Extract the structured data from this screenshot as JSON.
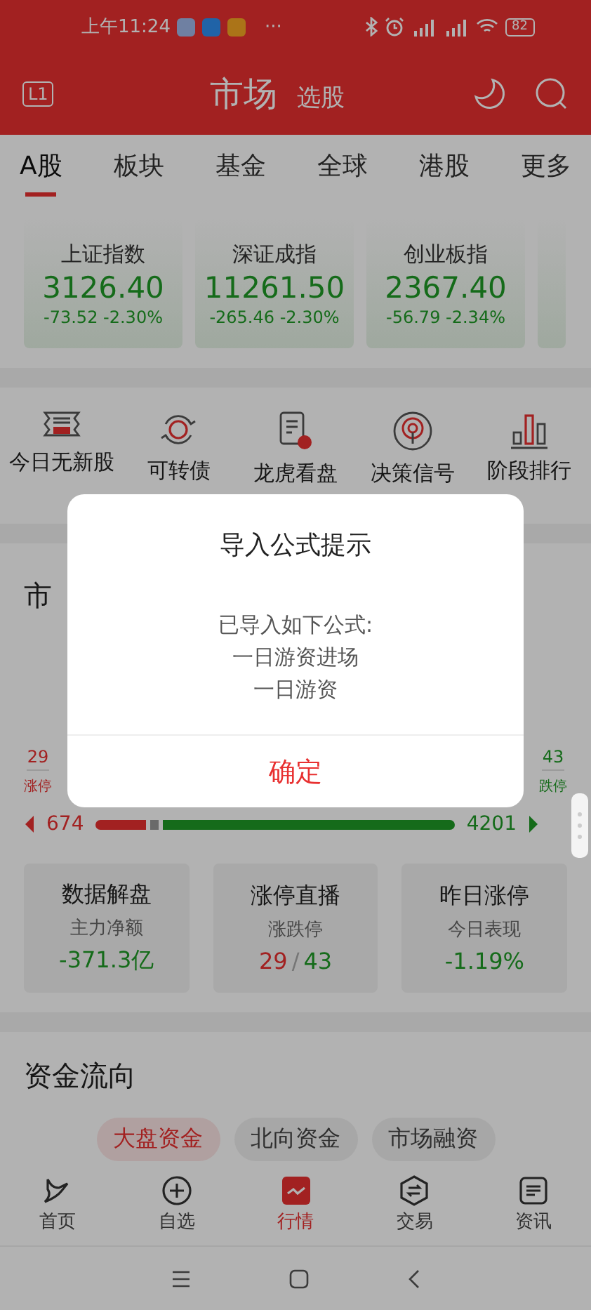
{
  "status_bar": {
    "time": "上午11:24",
    "more": "···",
    "battery": "82"
  },
  "header": {
    "badge": "L1",
    "title": "市场",
    "subtitle": "选股"
  },
  "tabs": [
    {
      "label": "A股",
      "selected": true
    },
    {
      "label": "板块",
      "selected": false
    },
    {
      "label": "基金",
      "selected": false
    },
    {
      "label": "全球",
      "selected": false
    },
    {
      "label": "港股",
      "selected": false
    },
    {
      "label": "更多",
      "selected": false
    }
  ],
  "indices": [
    {
      "name": "上证指数",
      "value": "3126.40",
      "change": "-73.52",
      "percent": "-2.30%"
    },
    {
      "name": "深证成指",
      "value": "11261.50",
      "change": "-265.46",
      "percent": "-2.30%"
    },
    {
      "name": "创业板指",
      "value": "2367.40",
      "change": "-56.79",
      "percent": "-2.34%"
    }
  ],
  "shortcuts": [
    {
      "label": "今日无新股"
    },
    {
      "label": "可转债"
    },
    {
      "label": "龙虎看盘"
    },
    {
      "label": "决策信号"
    },
    {
      "label": "阶段排行"
    }
  ],
  "market": {
    "title": "市",
    "limit_up": {
      "count": "29",
      "label": "涨停"
    },
    "limit_down": {
      "count": "43",
      "label": "跌停"
    },
    "up_count": "674",
    "down_count": "4201",
    "level": 0.14
  },
  "cards": [
    {
      "kind": "value",
      "title": "数据解盘",
      "subtitle": "主力净额",
      "value": "-371.3亿"
    },
    {
      "kind": "ratio",
      "title": "涨停直播",
      "subtitle": "涨跌停",
      "up": "29",
      "sep": "/",
      "down": "43"
    },
    {
      "kind": "value",
      "title": "昨日涨停",
      "subtitle": "今日表现",
      "value": "-1.19%"
    }
  ],
  "flow": {
    "title": "资金流向",
    "pills": [
      {
        "label": "大盘资金",
        "selected": true
      },
      {
        "label": "北向资金",
        "selected": false
      },
      {
        "label": "市场融资",
        "selected": false
      }
    ]
  },
  "nav": [
    {
      "label": "首页",
      "selected": false
    },
    {
      "label": "自选",
      "selected": false
    },
    {
      "label": "行情",
      "selected": true
    },
    {
      "label": "交易",
      "selected": false
    },
    {
      "label": "资讯",
      "selected": false
    }
  ],
  "dialog": {
    "title": "导入公式提示",
    "lines": [
      "已导入如下公式:",
      "一日游资进场",
      "一日游资"
    ],
    "button": "确定"
  }
}
